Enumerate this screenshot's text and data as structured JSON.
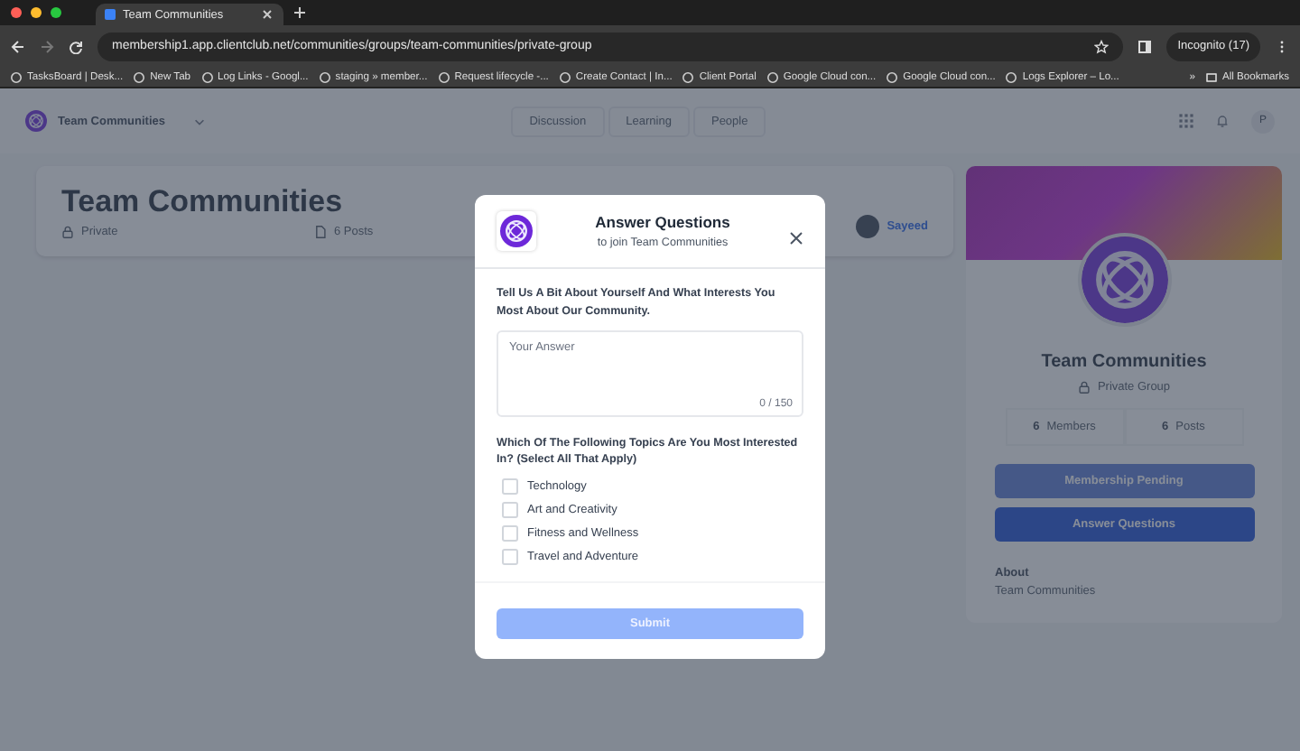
{
  "browser": {
    "tab": {
      "title": "Team Communities"
    },
    "url": "membership1.app.clientclub.net/communities/groups/team-communities/private-group",
    "incognito": "Incognito (17)",
    "bookmarks": [
      {
        "label": "TasksBoard | Desk..."
      },
      {
        "label": "New Tab"
      },
      {
        "label": "Log Links - Googl..."
      },
      {
        "label": "staging » member..."
      },
      {
        "label": "Request lifecycle -..."
      },
      {
        "label": "Create Contact | In..."
      },
      {
        "label": "Client Portal"
      },
      {
        "label": "Google Cloud con..."
      },
      {
        "label": "Google Cloud con..."
      },
      {
        "label": "Logs Explorer – Lo..."
      }
    ],
    "more": "»",
    "all_bookmarks": "All Bookmarks"
  },
  "page": {
    "dimmed": true,
    "header": {
      "community": "Team Communities",
      "nav": [
        "Discussion",
        "Learning",
        "People"
      ],
      "avatar": "P"
    },
    "group_card": {
      "title": "Team Communities",
      "privacy": "Private",
      "posts": "6 Posts",
      "member": "Sayeed"
    },
    "side_card": {
      "title": "Team Communities",
      "privacy": "Private Group",
      "stats": [
        {
          "value": "6",
          "label": "Members"
        },
        {
          "value": "6",
          "label": "Posts"
        }
      ],
      "buttons": [
        {
          "label": "Membership Pending",
          "disabled": true
        },
        {
          "label": "Answer Questions",
          "disabled": false
        }
      ],
      "about_heading": "About",
      "about_text": "Team Communities"
    }
  },
  "modal": {
    "title": "Answer Questions",
    "subtitle": "to join Team Communities",
    "question_1": "Tell Us A Bit About Yourself And What Interests You Most About Our Community.",
    "answer": {
      "placeholder": "Your Answer",
      "counter": "0 / 150"
    },
    "question_2": "Which Of The Following Topics Are You Most Interested In? (Select All That Apply)",
    "options": [
      {
        "label": "Technology",
        "checked": false
      },
      {
        "label": "Art and Creativity",
        "checked": false
      },
      {
        "label": "Fitness and Wellness",
        "checked": false
      },
      {
        "label": "Travel and Adventure",
        "checked": false
      }
    ],
    "submit": {
      "label": "Submit",
      "disabled": true
    }
  }
}
